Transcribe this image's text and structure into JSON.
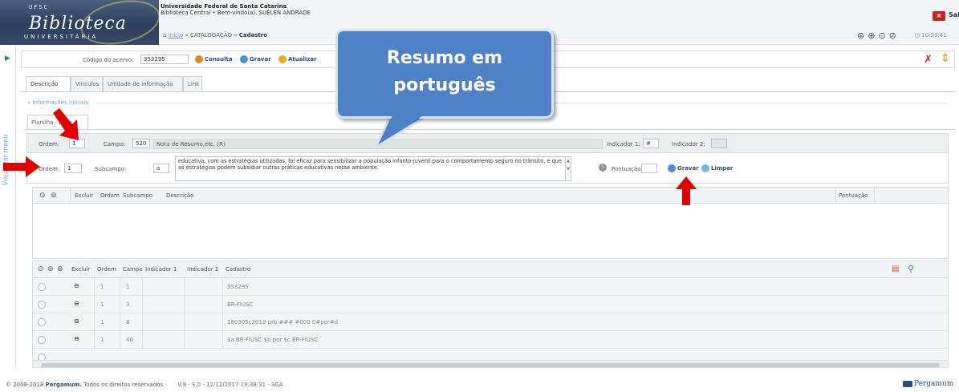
{
  "header": {
    "logo_ufsc": "UFSC",
    "logo_bib": "Biblioteca",
    "logo_univ": "UNIVERSITÁRIA",
    "inst_name": "Universidade Federal de Santa Catarina",
    "inst_sub": "Biblioteca Central • Bem-vindo(a). SUÉLEN ANDRADE",
    "crumb_home": "Início",
    "crumb_sep1": "»",
    "crumb_cat": "CATALOGAÇÃO",
    "crumb_sep2": "»",
    "crumb_current": "Cadastro",
    "sair": "Sair",
    "clock": "10:53:41"
  },
  "side": {
    "menu_label": "Visualizar menu"
  },
  "toolbar": {
    "codigo_label": "Código do acervo:",
    "codigo_value": "353295",
    "consulta": "Consulta",
    "gravar": "Gravar",
    "atualizar": "Atualizar"
  },
  "tabs": [
    "Descrição",
    "Vínculos",
    "Unidade de informação",
    "Link"
  ],
  "info_label": "» Informações iniciais",
  "subtab_label": "Planilha - Marc",
  "form": {
    "ordem_label": "Ordem:",
    "ordem1_value": "1",
    "campo_label": "Campo:",
    "campo_value": "520",
    "campo_desc": "Nota de Resumo,etc. (R)",
    "ind1_label": "Indicador 1:",
    "ind1_value": "#",
    "ind2_label": "Indicador 2:",
    "ordem2_value": "1",
    "subcampo_label": "Subcampo:",
    "subcampo_value": "a",
    "descricao_line1": "educativa, com as estratégias utilizadas, foi eficaz para sensibilizar a população infanto-juvenil para o comportamento seguro no trânsito, e que",
    "descricao_line2": "as estratégias podem subsidiar outras práticas educativas nesse ambiente.",
    "pontuacao_label": "Pontuação",
    "gravar": "Gravar",
    "limpar": "Limpar"
  },
  "table1": {
    "headers": [
      "Excluir",
      "Ordem",
      "Subcampo",
      "Descrição",
      "Pontuação"
    ]
  },
  "table2": {
    "headers": [
      "Excluir",
      "Ordem",
      "Campo",
      "Indicador 1",
      "Indicador 2",
      "Cadastro"
    ],
    "rows": [
      {
        "ordem": "1",
        "campo": "1",
        "ind1": "",
        "ind2": "",
        "cadastro": "353295"
      },
      {
        "ordem": "1",
        "campo": "3",
        "ind1": "",
        "ind2": "",
        "cadastro": "BR-FlUSC"
      },
      {
        "ordem": "1",
        "campo": "8",
        "ind1": "",
        "ind2": "",
        "cadastro": "180305c2013 prb ### #000 0#por#d"
      },
      {
        "ordem": "1",
        "campo": "40",
        "ind1": "",
        "ind2": "",
        "cadastro": "$a BR-FlUSC $b por $c BR-FlUSC"
      }
    ]
  },
  "footer": {
    "copyright": "© 2008-2018",
    "brand_bold": "Pergamum.",
    "rights": "Todos os direitos reservados",
    "version": "V.9 - S.0 - 12/12/2017 19:38:31 - SGA",
    "brand_logo": "Pergamum"
  },
  "callout": {
    "line1": "Resumo em",
    "line2": "português"
  },
  "colors": {
    "callout_fill": "#4f81c7",
    "arrow_red": "#e00000",
    "header_logo": "#2e3f5e",
    "link_blue": "#2b4a75"
  }
}
